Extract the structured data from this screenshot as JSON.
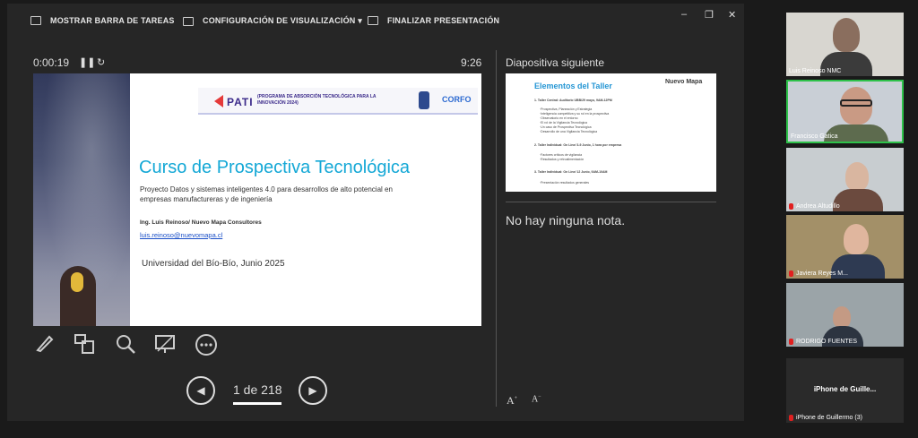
{
  "toolbar": {
    "taskbar_label": "MOSTRAR BARRA DE TAREAS",
    "display_settings_label": "CONFIGURACIÓN DE VISUALIZACIÓN ▾",
    "end_slideshow_label": "FINALIZAR PRESENTACIÓN",
    "minimize": "–",
    "restore": "❐",
    "close": "✕"
  },
  "timer": {
    "elapsed": "0:00:19",
    "pause_icon": "pause-icon",
    "restart_icon": "restart-icon",
    "clock": "9:26"
  },
  "current_slide": {
    "banner_program": "PATI",
    "banner_desc": "(PROGRAMA DE ABSORCIÓN TECNOLÓGICA PARA LA INNOVACIÓN 2024)",
    "banner_partner": "CORFO",
    "title": "Curso de Prospectiva Tecnológica",
    "subtitle": "Proyecto Datos y sistemas inteligentes 4.0 para desarrollos de alto potencial en empresas manufactureras y de ingeniería",
    "author": "Ing. Luis Reinoso/ Nuevo Mapa Consultores",
    "email": "luis.reinoso@nuevomapa.cl",
    "footer": "Universidad del Bío-Bío, Junio 2025"
  },
  "slide_tools": [
    "pen-icon",
    "all-slides-icon",
    "zoom-icon",
    "black-screen-icon",
    "more-options-icon"
  ],
  "navigation": {
    "prev": "◀",
    "next": "▶",
    "page_label": "1 de 218"
  },
  "next_slide": {
    "label": "Diapositiva siguiente",
    "title": "Elementos del Taller",
    "logo": "Nuevo Mapa",
    "lines": [
      "1. Taller Central: Auditorio UBB/29 mayo, 9AM-12PM",
      "·Prospectiva, Planeación y Estrategia",
      "·Inteligencia competitiva y su rol en la prospectiva",
      "·Observatorio en el entorno",
      "·El rol de la Vigilancia Tecnológica",
      "·Un caso de Prospectiva Tecnológica",
      "·Desarrollo de una Vigilancia Tecnológica",
      "2. Taller Individual: On Line/ 3-9 Junio, 1 hora por empresa",
      "·Factores críticos de vigilancia",
      "·Resultados y retroalimentación",
      "3. Taller Individual: On Line/ 12 Junio, 9AM-10AM",
      "·Presentación resultados generales"
    ]
  },
  "notes": {
    "text": "No hay ninguna nota.",
    "increase_font": "A",
    "decrease_font": "A"
  },
  "participants": [
    {
      "name": "Luis Reinoso NMC",
      "muted": false
    },
    {
      "name": "Francisco Gatica",
      "muted": false
    },
    {
      "name": "Andrea Altudillo",
      "muted": true
    },
    {
      "name": "Javiera Reyes M...",
      "muted": true
    },
    {
      "name": "RODRIGO FUENTES",
      "muted": true
    },
    {
      "name": "iPhone de Guillermo (3)",
      "muted": true,
      "center_label": "iPhone de Guille..."
    }
  ],
  "colors": {
    "title_blue": "#14a8d6",
    "active_speaker_border": "#2ec24a",
    "mic_muted": "#e02020"
  }
}
